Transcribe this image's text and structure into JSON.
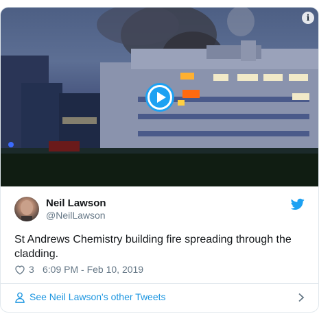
{
  "media": {
    "type": "video",
    "play_icon": "play-icon",
    "info_icon": "info-icon",
    "info_glyph": "i"
  },
  "author": {
    "name": "Neil Lawson",
    "handle": "@NeilLawson",
    "avatar_icon": "avatar",
    "platform_icon": "twitter-bird-icon"
  },
  "tweet": {
    "text": "St Andrews Chemistry building fire spreading through the cladding.",
    "likes": "3",
    "timestamp": "6:09 PM - Feb 10, 2019",
    "like_icon": "heart-icon"
  },
  "footer": {
    "link_text": "See Neil Lawson's other Tweets",
    "person_icon": "person-icon",
    "chevron_icon": "chevron-right-icon"
  },
  "colors": {
    "accent": "#1da1f2",
    "link": "#1b95e0",
    "secondary_text": "#657786",
    "border": "#e1e8ed"
  }
}
